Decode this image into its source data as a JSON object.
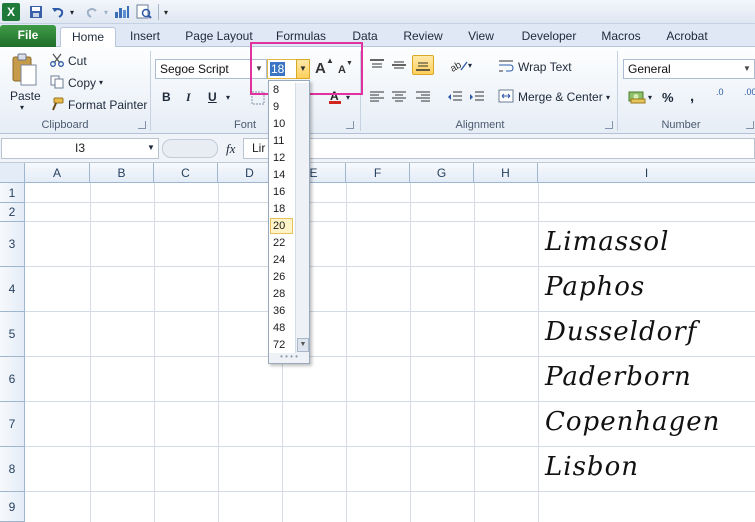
{
  "colors": {
    "accent_file": "#2b8a36",
    "highlight_box": "#e0329e",
    "selected_size": "#fff4c8"
  },
  "quick_access": {
    "logo": "X",
    "icons": [
      "excel-logo-icon",
      "save-icon",
      "undo-icon",
      "redo-icon",
      "chart-icon",
      "print-preview-icon",
      "customize-icon"
    ]
  },
  "tabs": [
    "File",
    "Home",
    "Insert",
    "Page Layout",
    "Formulas",
    "Data",
    "Review",
    "View",
    "Developer",
    "Macros",
    "Acrobat"
  ],
  "ribbon": {
    "clipboard": {
      "paste": "Paste",
      "cut": "Cut",
      "copy": "Copy",
      "format_painter": "Format Painter",
      "label": "Clipboard"
    },
    "font": {
      "name": "Segoe Script",
      "size": "18",
      "bold": "B",
      "italic": "I",
      "underline": "U",
      "grow": "A",
      "shrink": "A",
      "label": "Font"
    },
    "alignment": {
      "wrap_text": "Wrap Text",
      "merge_center": "Merge & Center",
      "label": "Alignment"
    },
    "number": {
      "format": "General",
      "percent": "%",
      "comma": ",",
      "inc_decimal": ".0",
      "dec_decimal": ".00",
      "label": "Number"
    }
  },
  "formula_bar": {
    "name_box": "I3",
    "fx": "fx",
    "content": "Lir"
  },
  "grid": {
    "columns": [
      "A",
      "B",
      "C",
      "D",
      "E",
      "F",
      "G",
      "H",
      "I"
    ],
    "rows": [
      "1",
      "2",
      "3",
      "4",
      "5",
      "6",
      "7",
      "8",
      "9"
    ],
    "cities": [
      "Limassol",
      "Paphos",
      "Dusseldorf",
      "Paderborn",
      "Copenhagen",
      "Lisbon"
    ]
  },
  "font_size_list": [
    "8",
    "9",
    "10",
    "11",
    "12",
    "14",
    "16",
    "18",
    "20",
    "22",
    "24",
    "26",
    "28",
    "36",
    "48",
    "72"
  ],
  "font_size_highlighted": "20"
}
